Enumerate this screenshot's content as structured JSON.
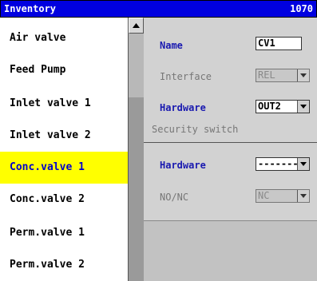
{
  "titlebar": {
    "title": "Inventory",
    "code": "1070"
  },
  "list": {
    "items": [
      "Air valve",
      "Feed Pump",
      "Inlet valve 1",
      "Inlet valve 2",
      "Conc.valve 1",
      "Conc.valve 2",
      "Perm.valve 1",
      "Perm.valve 2"
    ],
    "selected": "Conc.valve 1"
  },
  "details": {
    "name_label": "Name",
    "name_value": "CV1",
    "interface_label": "Interface",
    "interface_value": "REL",
    "hardware_label": "Hardware",
    "hardware_value": "OUT2",
    "security_heading": "Security switch",
    "security_hardware_label": "Hardware",
    "security_hardware_value": "-------",
    "nonc_label": "NO/NC",
    "nonc_value": "NC"
  },
  "colors": {
    "titlebar": "#0000e0",
    "selection": "#ffff00",
    "label_blue": "#1a1ab0"
  }
}
